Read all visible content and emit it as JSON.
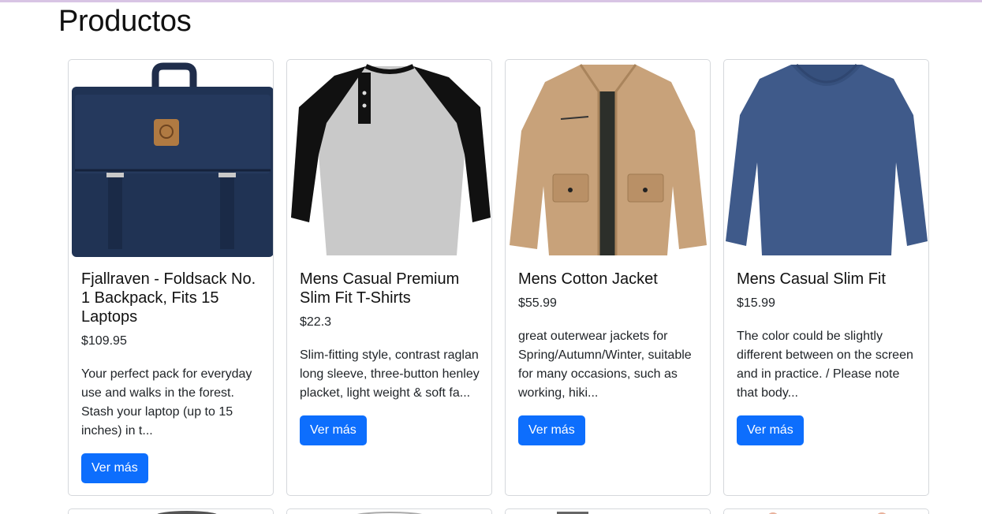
{
  "page": {
    "title": "Productos"
  },
  "products": [
    {
      "title": "Fjallraven - Foldsack No. 1 Backpack, Fits 15 Laptops",
      "price": "$109.95",
      "description": "Your perfect pack for everyday use and walks in the forest. Stash your laptop (up to 15 inches) in t...",
      "button": "Ver más",
      "image_icon": "backpack-image"
    },
    {
      "title": "Mens Casual Premium Slim Fit T-Shirts",
      "price": "$22.3",
      "description": "Slim-fitting style, contrast raglan long sleeve, three-button henley placket, light weight & soft fa...",
      "button": "Ver más",
      "image_icon": "raglan-shirt-image"
    },
    {
      "title": "Mens Cotton Jacket",
      "price": "$55.99",
      "description": "great outerwear jackets for Spring/Autumn/Winter, suitable for many occasions, such as working, hiki...",
      "button": "Ver más",
      "image_icon": "jacket-image"
    },
    {
      "title": "Mens Casual Slim Fit",
      "price": "$15.99",
      "description": "The color could be slightly different between on the screen and in practice. / Please note that body...",
      "button": "Ver más",
      "image_icon": "long-sleeve-shirt-image"
    }
  ],
  "colors": {
    "accent": "#0d6efd",
    "border": "#d5d8dc",
    "text": "#212529"
  }
}
